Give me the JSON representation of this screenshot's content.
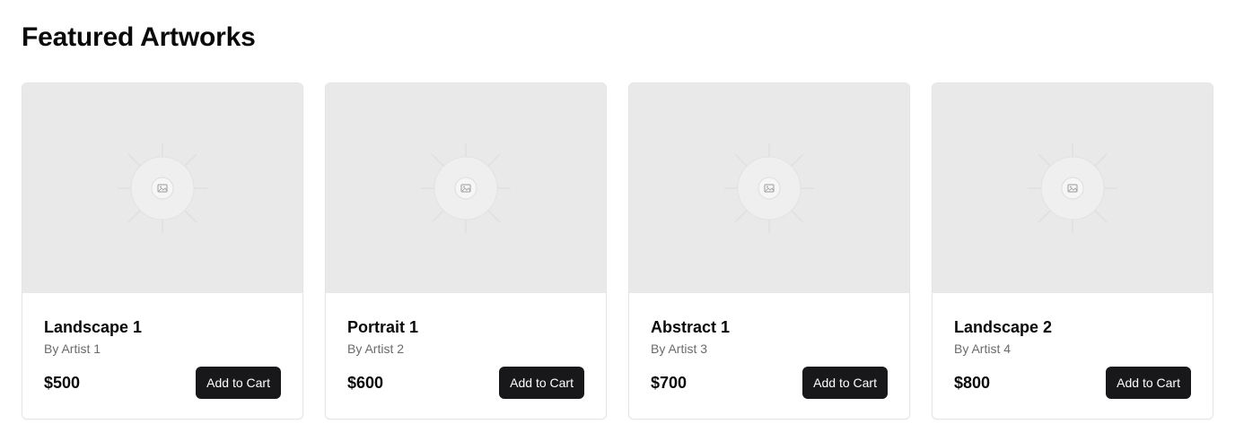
{
  "page": {
    "title": "Featured Artworks"
  },
  "artworks": [
    {
      "title": "Landscape 1",
      "artist": "By Artist 1",
      "price": "$500",
      "button_label": "Add to Cart",
      "image_icon": "image-placeholder-icon"
    },
    {
      "title": "Portrait 1",
      "artist": "By Artist 2",
      "price": "$600",
      "button_label": "Add to Cart",
      "image_icon": "image-placeholder-icon"
    },
    {
      "title": "Abstract 1",
      "artist": "By Artist 3",
      "price": "$700",
      "button_label": "Add to Cart",
      "image_icon": "image-placeholder-icon"
    },
    {
      "title": "Landscape 2",
      "artist": "By Artist 4",
      "price": "$800",
      "button_label": "Add to Cart",
      "image_icon": "image-placeholder-icon"
    }
  ],
  "colors": {
    "button_background": "#18181b",
    "placeholder_background": "#e9e9e9",
    "muted_text": "#6b6b6b"
  }
}
